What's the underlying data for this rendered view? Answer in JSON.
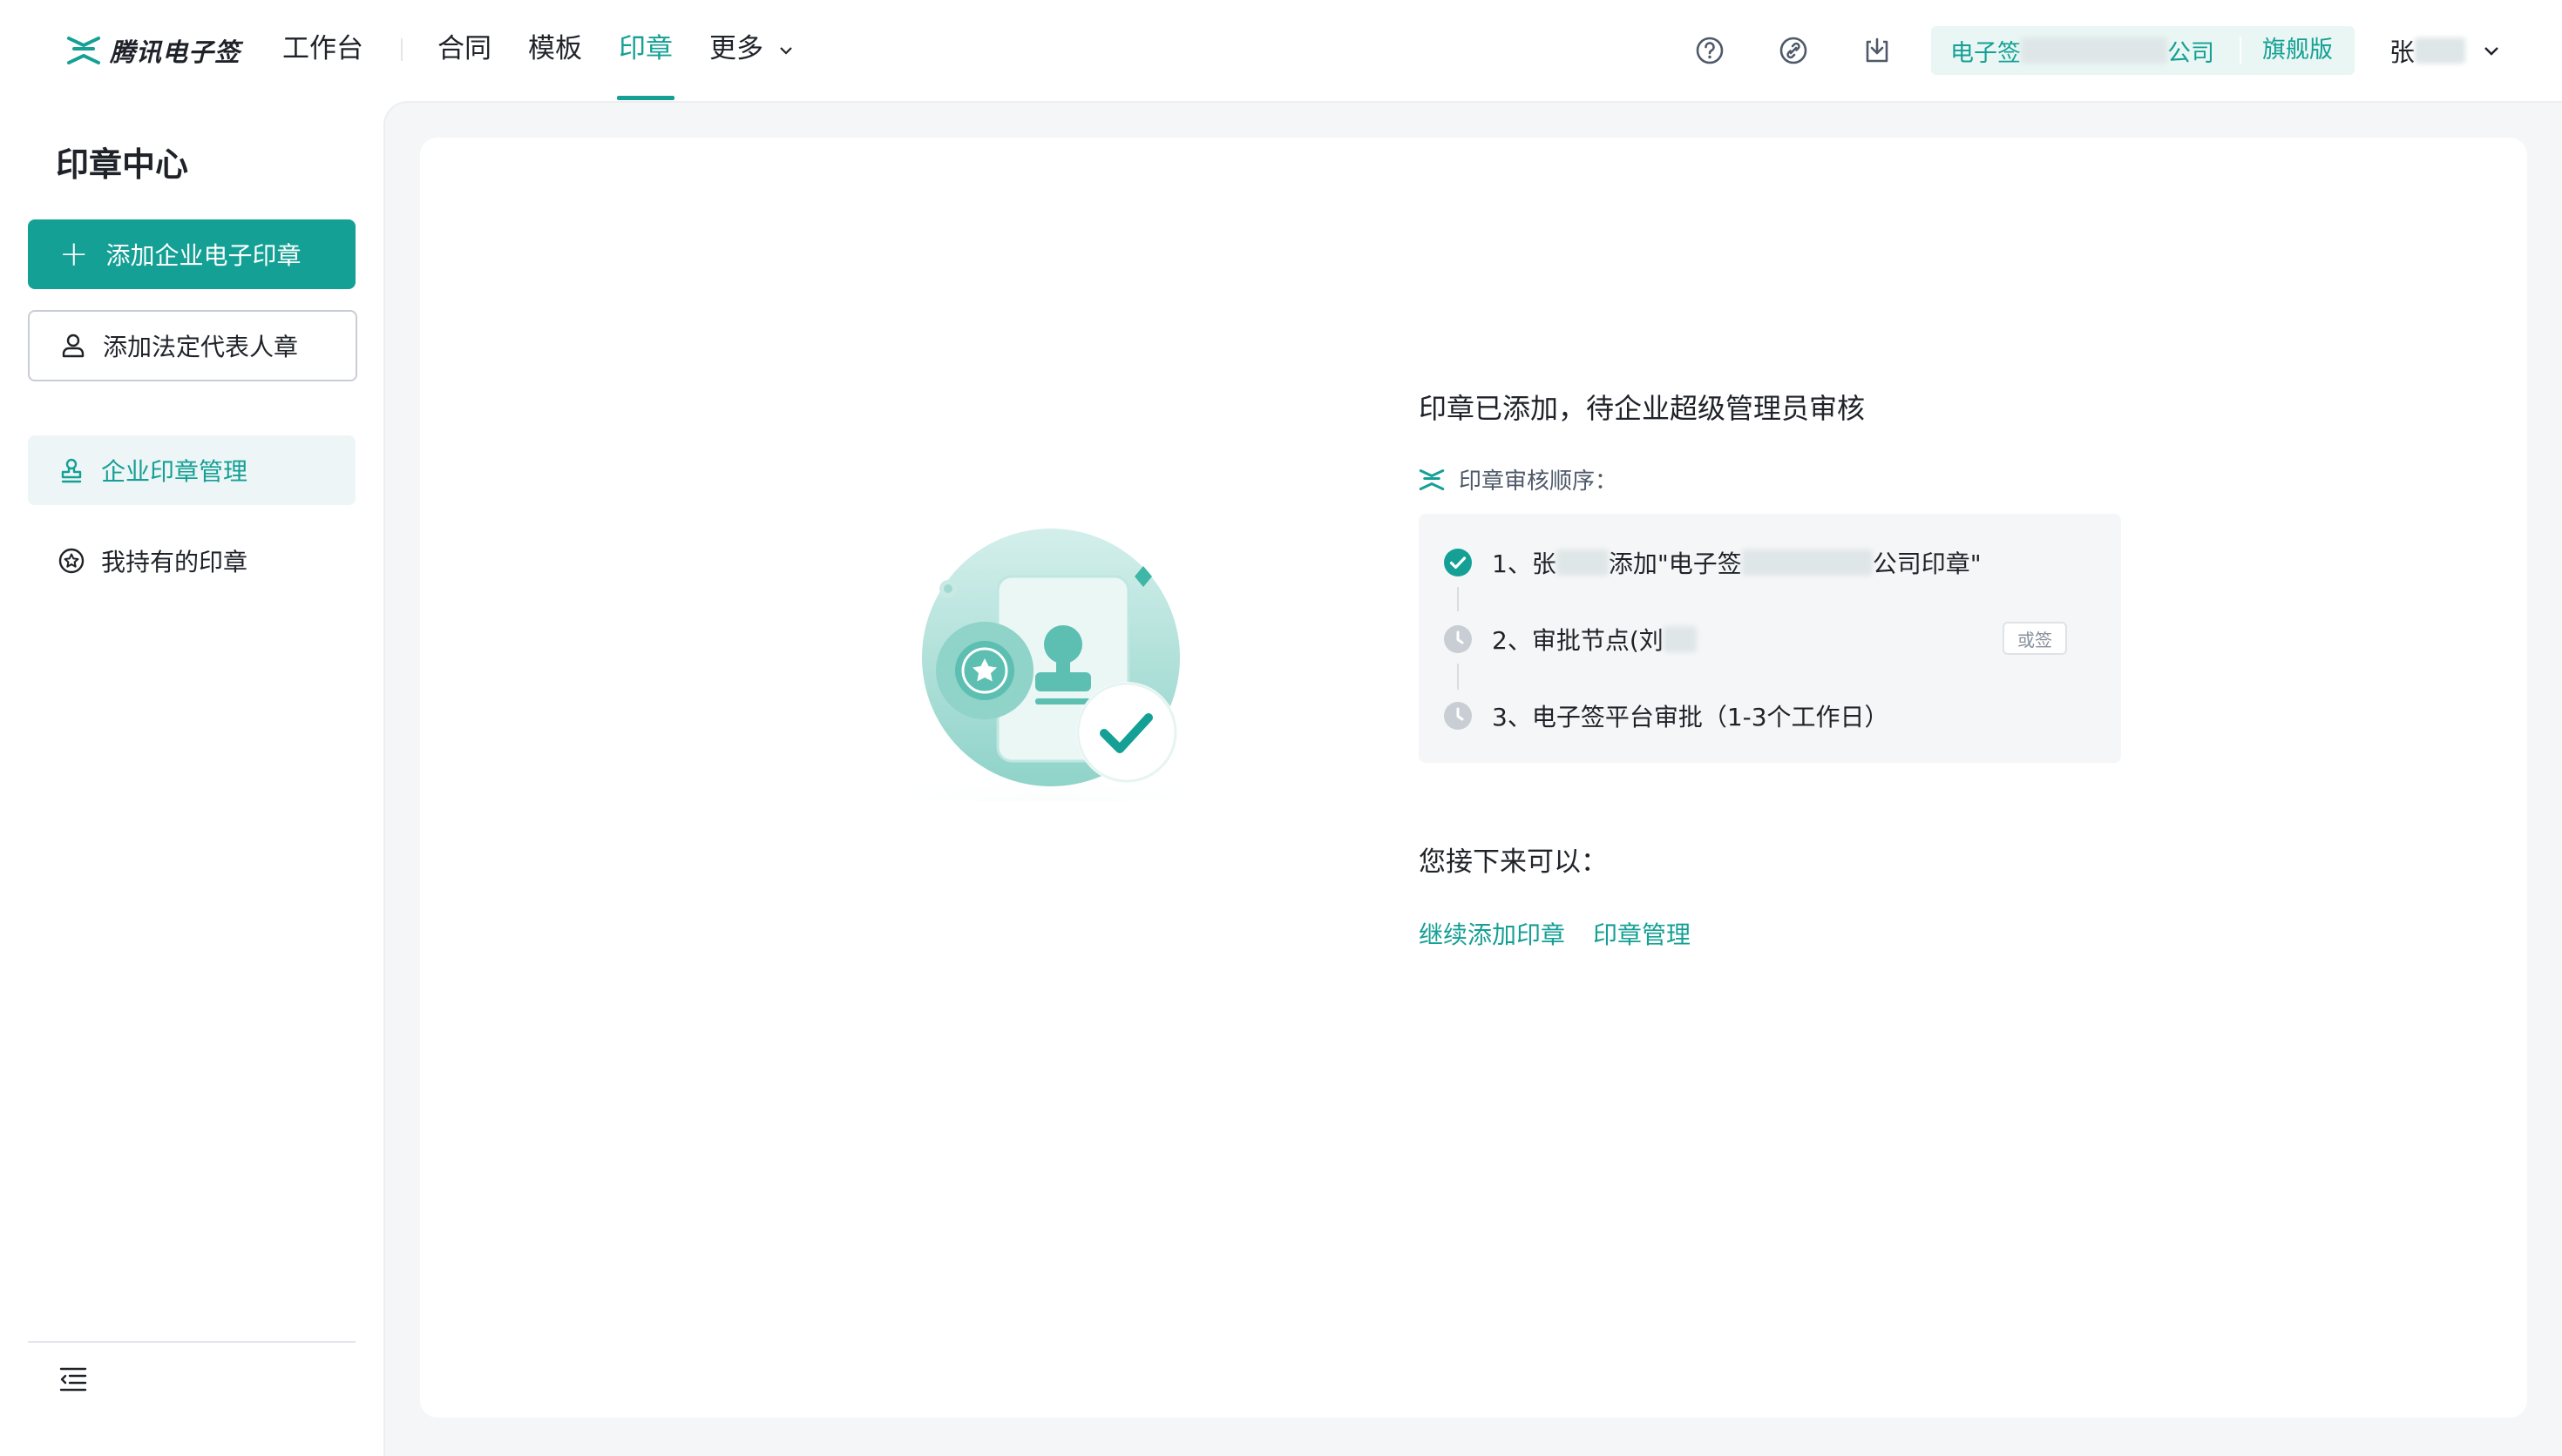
{
  "header": {
    "logo_text": "腾讯电子签",
    "nav": {
      "workbench": "工作台",
      "contracts": "合同",
      "templates": "模板",
      "seals": "印章",
      "more": "更多"
    },
    "org": {
      "name_prefix": "电子签",
      "name_suffix": "公司",
      "plan": "旗舰版"
    },
    "user": {
      "name": "张"
    },
    "icons": [
      "help-icon",
      "link-icon",
      "download-icon",
      "chevron-down-icon"
    ]
  },
  "sidebar": {
    "title": "印章中心",
    "add_company_seal": "添加企业电子印章",
    "add_legal_rep_seal": "添加法定代表人章",
    "items": [
      {
        "label": "企业印章管理",
        "active": true
      },
      {
        "label": "我持有的印章",
        "active": false
      }
    ]
  },
  "result": {
    "title": "印章已添加，待企业超级管理员审核",
    "sequence_label": "印章审核顺序：",
    "steps": [
      {
        "prefix": "1、张",
        "mid": "添加\"电子签",
        "suffix": "公司印章\"",
        "status": "done"
      },
      {
        "prefix": "2、审批节点(刘",
        "status": "pending",
        "tag": "或签"
      },
      {
        "prefix": "3、电子签平台审批（1-3个工作日）",
        "status": "pending"
      }
    ],
    "next_title": "您接下来可以：",
    "links": [
      "继续添加印章",
      "印章管理"
    ]
  },
  "colors": {
    "accent": "#14a095",
    "accent_light": "#e9f6f3",
    "text": "#1f2329",
    "muted": "#86909c",
    "bg": "#f5f6f7"
  }
}
